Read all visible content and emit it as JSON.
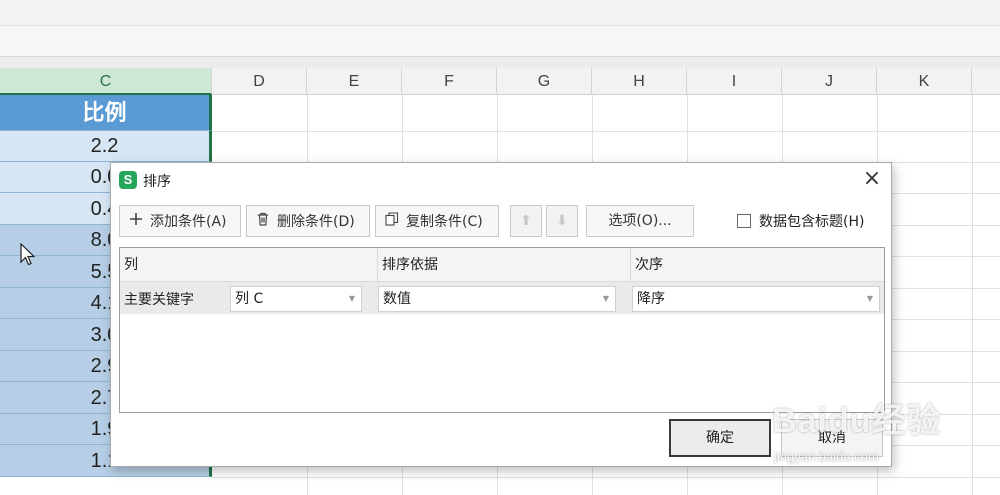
{
  "sheet": {
    "columns": [
      "C",
      "D",
      "E",
      "F",
      "G",
      "H",
      "I",
      "J",
      "K"
    ],
    "selected_column": "C",
    "column_c": {
      "header": "比例",
      "values": [
        "2.2",
        "0.0",
        "0.4",
        "8.0",
        "5.5",
        "4.1",
        "3.0",
        "2.9",
        "2.7",
        "1.9",
        "1.1"
      ]
    }
  },
  "dialog": {
    "title": "排序",
    "app_icon_letter": "S",
    "close_symbol": "×",
    "toolbar": {
      "add_condition": "添加条件(A)",
      "delete_condition": "删除条件(D)",
      "copy_condition": "复制条件(C)",
      "move_up": "⬆",
      "move_down": "⬇",
      "options": "选项(O)...",
      "header_checkbox_label": "数据包含标题(H)",
      "header_checkbox_checked": false
    },
    "table": {
      "headers": [
        "列",
        "排序依据",
        "次序"
      ],
      "row": {
        "label": "主要关键字",
        "column": "列 C",
        "sort_on": "数值",
        "order": "降序"
      }
    },
    "ok_label": "确定",
    "cancel_label": "取消"
  },
  "watermark": {
    "brand": "Baidu经验",
    "url": "jingyan.baidu.com"
  },
  "colors": {
    "excel_green": "#217346",
    "header_blue": "#5b9bd5",
    "cell_light_blue": "#d6e6f5",
    "cell_mid_blue": "#b6cfe6",
    "wps_icon_green": "#26a65b"
  },
  "icons": {
    "add": "plus-icon",
    "delete": "trash-icon",
    "copy": "copy-icon",
    "up": "arrow-up-icon",
    "down": "arrow-down-icon",
    "dropdown": "chevron-down-icon",
    "cursor": "mouse-pointer-icon"
  }
}
